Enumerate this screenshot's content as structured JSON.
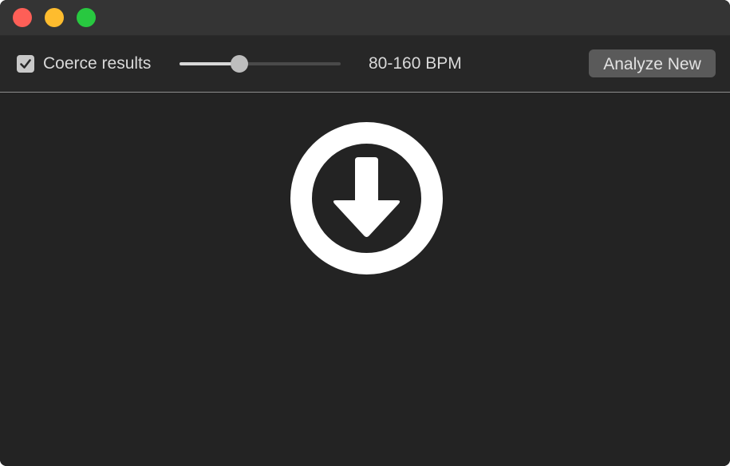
{
  "window": {
    "controls": {
      "close_color": "#fe5f57",
      "minimize_color": "#febc2e",
      "zoom_color": "#28c840"
    }
  },
  "toolbar": {
    "coerce_checkbox": {
      "label": "Coerce results",
      "checked": true
    },
    "tempo_slider": {
      "value_fraction": 0.37
    },
    "bpm_range": "80-160 BPM",
    "analyze_button": "Analyze New"
  },
  "main": {
    "icon": "download-arrow-circle-icon"
  },
  "colors": {
    "background": "#232323",
    "toolbar": "#272727",
    "titlebar": "#343434",
    "text": "#d9d9d9",
    "button": "#5a5a5a"
  }
}
